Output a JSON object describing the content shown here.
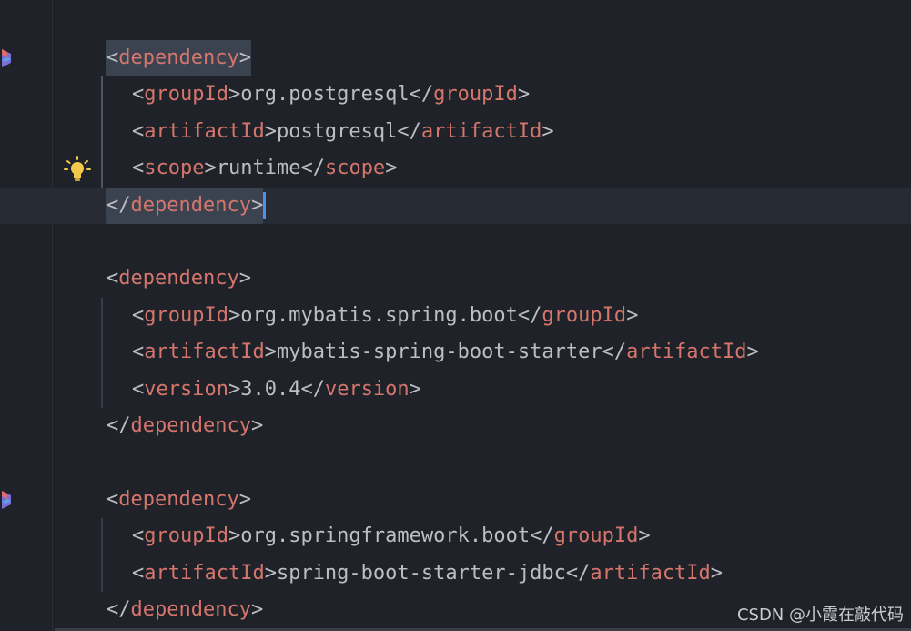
{
  "editor": {
    "lines": [
      {
        "row": 1,
        "indent": 1,
        "tokens": [
          {
            "t": "br",
            "v": "<"
          },
          {
            "t": "tag",
            "v": "dependency"
          },
          {
            "t": "br",
            "v": ">"
          }
        ],
        "highlight": true
      },
      {
        "row": 2,
        "indent": 2,
        "tokens": [
          {
            "t": "br",
            "v": "<"
          },
          {
            "t": "tag",
            "v": "groupId"
          },
          {
            "t": "br",
            "v": ">"
          },
          {
            "t": "txt",
            "v": "org.postgresql"
          },
          {
            "t": "br",
            "v": "</"
          },
          {
            "t": "tag",
            "v": "groupId"
          },
          {
            "t": "br",
            "v": ">"
          }
        ]
      },
      {
        "row": 3,
        "indent": 2,
        "tokens": [
          {
            "t": "br",
            "v": "<"
          },
          {
            "t": "tag",
            "v": "artifactId"
          },
          {
            "t": "br",
            "v": ">"
          },
          {
            "t": "txt",
            "v": "postgresql"
          },
          {
            "t": "br",
            "v": "</"
          },
          {
            "t": "tag",
            "v": "artifactId"
          },
          {
            "t": "br",
            "v": ">"
          }
        ]
      },
      {
        "row": 4,
        "indent": 2,
        "tokens": [
          {
            "t": "br",
            "v": "<"
          },
          {
            "t": "tag",
            "v": "scope"
          },
          {
            "t": "br",
            "v": ">"
          },
          {
            "t": "txt",
            "v": "runtime"
          },
          {
            "t": "br",
            "v": "</"
          },
          {
            "t": "tag",
            "v": "scope"
          },
          {
            "t": "br",
            "v": ">"
          }
        ]
      },
      {
        "row": 5,
        "indent": 1,
        "tokens": [
          {
            "t": "br",
            "v": "</"
          },
          {
            "t": "tag",
            "v": "dependency"
          },
          {
            "t": "br",
            "v": ">"
          }
        ],
        "highlight": true,
        "caret_line": true
      },
      {
        "row": 7,
        "indent": 1,
        "tokens": [
          {
            "t": "br",
            "v": "<"
          },
          {
            "t": "tag",
            "v": "dependency"
          },
          {
            "t": "br",
            "v": ">"
          }
        ]
      },
      {
        "row": 8,
        "indent": 2,
        "tokens": [
          {
            "t": "br",
            "v": "<"
          },
          {
            "t": "tag",
            "v": "groupId"
          },
          {
            "t": "br",
            "v": ">"
          },
          {
            "t": "txt",
            "v": "org.mybatis.spring.boot"
          },
          {
            "t": "br",
            "v": "</"
          },
          {
            "t": "tag",
            "v": "groupId"
          },
          {
            "t": "br",
            "v": ">"
          }
        ]
      },
      {
        "row": 9,
        "indent": 2,
        "tokens": [
          {
            "t": "br",
            "v": "<"
          },
          {
            "t": "tag",
            "v": "artifactId"
          },
          {
            "t": "br",
            "v": ">"
          },
          {
            "t": "txt",
            "v": "mybatis-spring-boot-starter"
          },
          {
            "t": "br",
            "v": "</"
          },
          {
            "t": "tag",
            "v": "artifactId"
          },
          {
            "t": "br",
            "v": ">"
          }
        ]
      },
      {
        "row": 10,
        "indent": 2,
        "tokens": [
          {
            "t": "br",
            "v": "<"
          },
          {
            "t": "tag",
            "v": "version"
          },
          {
            "t": "br",
            "v": ">"
          },
          {
            "t": "txt",
            "v": "3.0.4"
          },
          {
            "t": "br",
            "v": "</"
          },
          {
            "t": "tag",
            "v": "version"
          },
          {
            "t": "br",
            "v": ">"
          }
        ]
      },
      {
        "row": 11,
        "indent": 1,
        "tokens": [
          {
            "t": "br",
            "v": "</"
          },
          {
            "t": "tag",
            "v": "dependency"
          },
          {
            "t": "br",
            "v": ">"
          }
        ]
      },
      {
        "row": 13,
        "indent": 1,
        "tokens": [
          {
            "t": "br",
            "v": "<"
          },
          {
            "t": "tag",
            "v": "dependency"
          },
          {
            "t": "br",
            "v": ">"
          }
        ]
      },
      {
        "row": 14,
        "indent": 2,
        "tokens": [
          {
            "t": "br",
            "v": "<"
          },
          {
            "t": "tag",
            "v": "groupId"
          },
          {
            "t": "br",
            "v": ">"
          },
          {
            "t": "txt",
            "v": "org.springframework.boot"
          },
          {
            "t": "br",
            "v": "</"
          },
          {
            "t": "tag",
            "v": "groupId"
          },
          {
            "t": "br",
            "v": ">"
          }
        ]
      },
      {
        "row": 15,
        "indent": 2,
        "tokens": [
          {
            "t": "br",
            "v": "<"
          },
          {
            "t": "tag",
            "v": "artifactId"
          },
          {
            "t": "br",
            "v": ">"
          },
          {
            "t": "txt",
            "v": "spring-boot-starter-jdbc"
          },
          {
            "t": "br",
            "v": "</"
          },
          {
            "t": "tag",
            "v": "artifactId"
          },
          {
            "t": "br",
            "v": ">"
          }
        ]
      },
      {
        "row": 16,
        "indent": 1,
        "tokens": [
          {
            "t": "br",
            "v": "</"
          },
          {
            "t": "tag",
            "v": "dependency"
          },
          {
            "t": "br",
            "v": ">"
          }
        ]
      }
    ],
    "gutter_icons": [
      {
        "row": 1,
        "icon": "maven-dependency-icon"
      },
      {
        "row": 4,
        "icon": "lightbulb-icon"
      },
      {
        "row": 13,
        "icon": "maven-dependency-icon"
      }
    ]
  },
  "colors": {
    "background": "#1f2228",
    "tag": "#d5756c",
    "bracket": "#bcbec4",
    "text": "#bcbec4",
    "caret": "#4d8ef7",
    "lightbulb": "#f2c94c"
  },
  "watermark": "CSDN @小霞在敲代码"
}
